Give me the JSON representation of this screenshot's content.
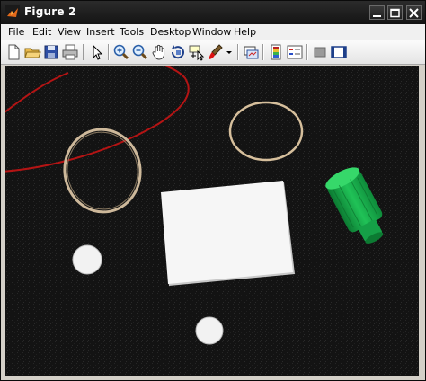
{
  "window": {
    "title": "Figure 2"
  },
  "menu": [
    "File",
    "Edit",
    "View",
    "Insert",
    "Tools",
    "Desktop",
    "Window",
    "Help"
  ],
  "toolbar": {
    "icons": [
      "new-figure-icon",
      "open-file-icon",
      "save-icon",
      "print-icon",
      "select-arrow-icon",
      "zoom-in-icon",
      "zoom-out-icon",
      "pan-hand-icon",
      "rotate-3d-icon",
      "data-cursor-icon",
      "brush-icon",
      "brush-dropdown-icon",
      "link-plot-icon",
      "colorbar-icon",
      "legend-icon",
      "hide-plot-tools-icon",
      "show-plot-tools-icon"
    ]
  },
  "colors": {
    "titlebar": "#1b1b1b",
    "selection_curve": "#b41414",
    "object_green": "#18b04a",
    "background_dark": "#121212"
  }
}
